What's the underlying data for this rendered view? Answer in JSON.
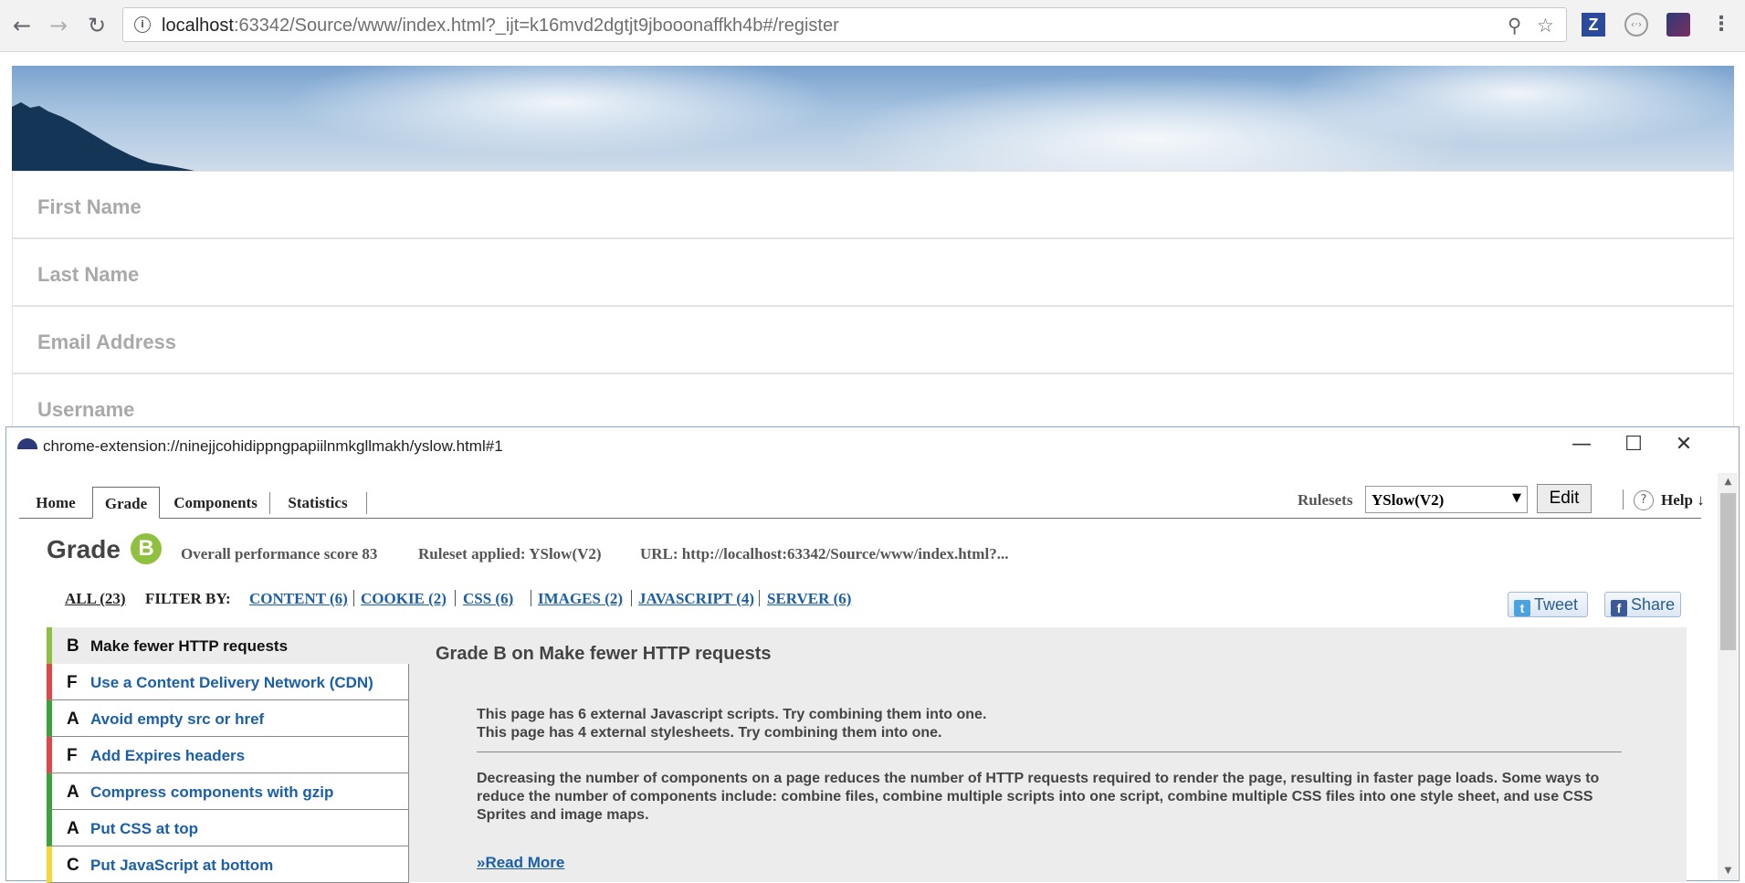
{
  "browser": {
    "url_host": "localhost",
    "url_rest": ":63342/Source/www/index.html?_ijt=k16mvd2dgtjt9jbooonaffkh4b#/register",
    "nav": {
      "back": "←",
      "forward": "→",
      "reload": "↻"
    },
    "icons": [
      "site-info-icon",
      "zoom-icon",
      "bookmark-star-icon",
      "zotero-extension-icon",
      "extension-icon",
      "yslow-extension-icon",
      "menu-icon"
    ],
    "ext_z_label": "Z"
  },
  "page": {
    "fields": [
      "First Name",
      "Last Name",
      "Email Address",
      "Username"
    ]
  },
  "popup": {
    "title": "chrome-extension://ninejjcohidippngpapiilnmkgllmakh/yslow.html#1",
    "tabs": [
      "Home",
      "Grade",
      "Components",
      "Statistics"
    ],
    "active_tab": "Grade",
    "rulesets_label": "Rulesets",
    "ruleset_value": "YSlow(V2)",
    "edit_label": "Edit",
    "help_label": "Help ↓",
    "grade_label": "Grade",
    "grade": "B",
    "score_text": "Overall performance score 83",
    "ruleset_applied": "Ruleset applied: YSlow(V2)",
    "url_text": "URL: http://localhost:63342/Source/www/index.html?...",
    "filter": {
      "all": "ALL (23)",
      "filter_by": "FILTER BY:",
      "items": [
        "CONTENT (6)",
        "COOKIE (2)",
        "CSS (6)",
        "IMAGES (2)",
        "JAVASCRIPT (4)",
        "SERVER (6)"
      ]
    },
    "social": {
      "tweet": "Tweet",
      "share": "Share"
    },
    "rules": [
      {
        "grade": "B",
        "name": "Make fewer HTTP requests",
        "color": "#8fc03f",
        "selected": true
      },
      {
        "grade": "F",
        "name": "Use a Content Delivery Network (CDN)",
        "color": "#e04848"
      },
      {
        "grade": "A",
        "name": "Avoid empty src or href",
        "color": "#3aa23a"
      },
      {
        "grade": "F",
        "name": "Add Expires headers",
        "color": "#e04848"
      },
      {
        "grade": "A",
        "name": "Compress components with gzip",
        "color": "#3aa23a"
      },
      {
        "grade": "A",
        "name": "Put CSS at top",
        "color": "#3aa23a"
      },
      {
        "grade": "C",
        "name": "Put JavaScript at bottom",
        "color": "#f4d936"
      }
    ],
    "detail": {
      "heading": "Grade B on Make fewer HTTP requests",
      "messages": [
        "This page has 6 external Javascript scripts. Try combining them into one.",
        "This page has 4 external stylesheets. Try combining them into one."
      ],
      "description": "Decreasing the number of components on a page reduces the number of HTTP requests required to render the page, resulting in faster page loads. Some ways to reduce the number of components include: combine files, combine multiple scripts into one script, combine multiple CSS files into one style sheet, and use CSS Sprites and image maps.",
      "read_more": "»Read More"
    }
  }
}
